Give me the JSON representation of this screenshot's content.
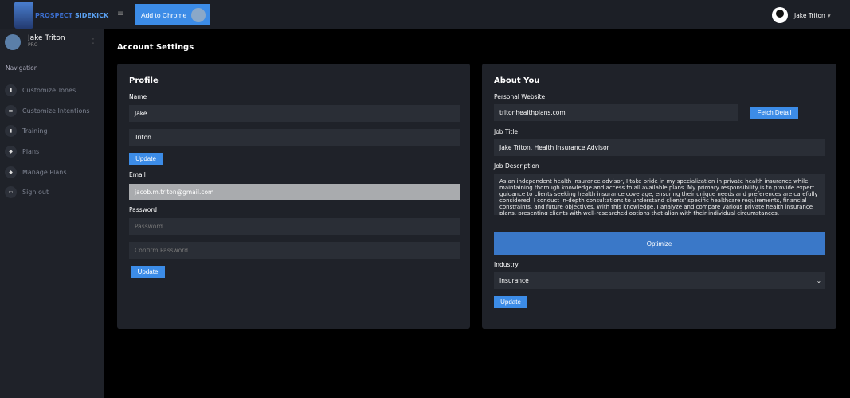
{
  "brand": {
    "name1": "PROSPECT",
    "name2": "SIDEKICK"
  },
  "topbar": {
    "add_chrome": "Add to Chrome",
    "user": "Jake Triton",
    "menu": "≡",
    "caret": "▾"
  },
  "sidebar": {
    "user_name": "Jake Triton",
    "plan": "PRO",
    "nav_heading": "Navigation",
    "items": [
      {
        "label": "Customize Tones",
        "icon": "clipboard-icon"
      },
      {
        "label": "Customize Intentions",
        "icon": "hat-icon"
      },
      {
        "label": "Training",
        "icon": "clipboard-icon"
      },
      {
        "label": "Plans",
        "icon": "diamond-icon"
      },
      {
        "label": "Manage Plans",
        "icon": "diamond-icon"
      },
      {
        "label": "Sign out",
        "icon": "card-icon"
      }
    ]
  },
  "page": {
    "title": "Account Settings"
  },
  "profile": {
    "title": "Profile",
    "name_label": "Name",
    "first_name": "Jake",
    "last_name": "Triton",
    "update": "Update",
    "email_label": "Email",
    "email": "jacob.m.triton@gmail.com",
    "password_label": "Password",
    "password_ph": "Password",
    "confirm_ph": "Confirm Password",
    "update2": "Update"
  },
  "about": {
    "title": "About You",
    "website_label": "Personal Website",
    "website": "tritonhealthplans.com",
    "fetch": "Fetch Detail",
    "job_title_label": "Job Title",
    "job_title": "Jake Triton, Health Insurance Advisor",
    "job_desc_label": "Job Description",
    "job_desc": "As an independent health insurance advisor, I take pride in my specialization in private health insurance while maintaining thorough knowledge and access to all available plans. My primary responsibility is to provide expert guidance to clients seeking health insurance coverage, ensuring their unique needs and preferences are carefully considered. I conduct in-depth consultations to understand clients' specific healthcare requirements, financial constraints, and future objectives. With this knowledge, I analyze and compare various private health insurance plans, presenting clients with well-researched options that align with their individual circumstances.",
    "optimize": "Optimize",
    "industry_label": "Industry",
    "industry": "Insurance",
    "update": "Update"
  }
}
